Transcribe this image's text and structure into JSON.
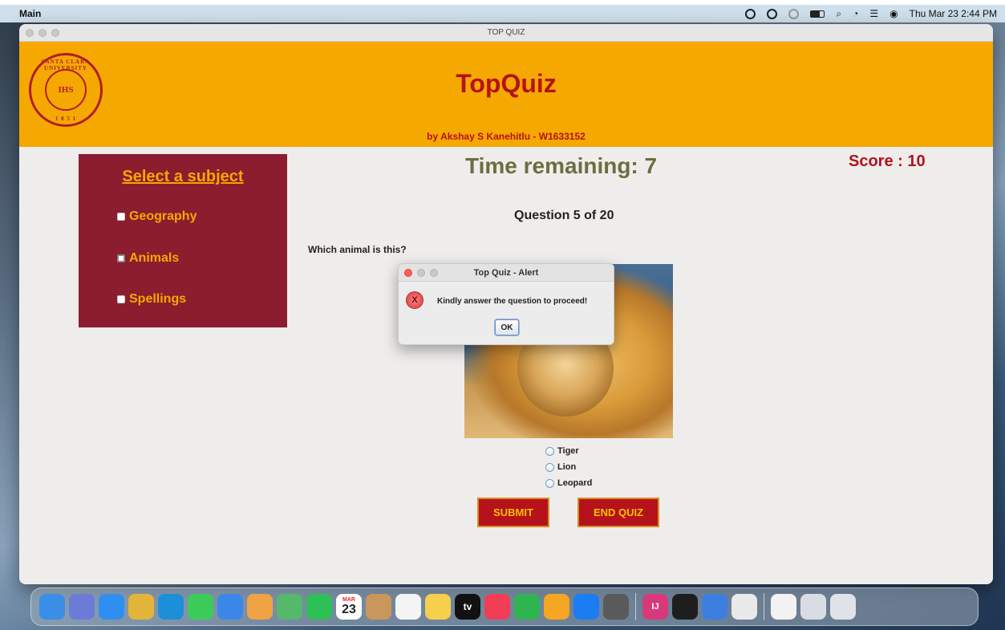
{
  "menubar": {
    "app_name": "Main",
    "datetime": "Thu Mar 23  2:44 PM"
  },
  "window": {
    "title": "TOP QUIZ"
  },
  "header": {
    "title": "TopQuiz",
    "subtitle": "by Akshay S Kanehitlu - W1633152",
    "seal": {
      "ring_top": "SANTA CLARA UNIVERSITY",
      "ring_bottom": "1 8 5 1",
      "center": "IHS"
    }
  },
  "quiz": {
    "time_remaining": "Time remaining: 7",
    "score": "Score : 10",
    "question_number": "Question 5 of 20",
    "question_text": "Which animal is this?",
    "options": [
      "Tiger",
      "Lion",
      "Leopard"
    ],
    "submit_label": "SUBMIT",
    "end_label": "END QUIZ"
  },
  "subjects": {
    "heading": "Select a subject",
    "items": [
      "Geography",
      "Animals",
      "Spellings"
    ],
    "selected": "Animals"
  },
  "alert": {
    "title": "Top Quiz - Alert",
    "icon_text": "X",
    "message": "Kindly answer the question to proceed!",
    "ok_label": "OK"
  },
  "dock": {
    "calendar_month": "MAR",
    "calendar_day": "23",
    "tv_label": "tv",
    "ij_label": "IJ",
    "icons": [
      {
        "name": "finder-icon",
        "color": "#3a8ee6"
      },
      {
        "name": "launchpad-icon",
        "color": "#6c7bd6"
      },
      {
        "name": "safari-icon",
        "color": "#2f8ff0"
      },
      {
        "name": "chrome-icon",
        "color": "#e2b43a"
      },
      {
        "name": "edge-icon",
        "color": "#1c8fd8"
      },
      {
        "name": "messages-icon",
        "color": "#3ccb5a"
      },
      {
        "name": "mail-icon",
        "color": "#3b87e8"
      },
      {
        "name": "photos-icon",
        "color": "#f0a345"
      },
      {
        "name": "maps-icon",
        "color": "#55b86b"
      },
      {
        "name": "facetime-icon",
        "color": "#2fbf57"
      },
      {
        "name": "calendar-icon",
        "color": "#ffffff"
      },
      {
        "name": "contacts-icon",
        "color": "#c9975c"
      },
      {
        "name": "reminders-icon",
        "color": "#f4f4f4"
      },
      {
        "name": "notes-icon",
        "color": "#f6d04d"
      },
      {
        "name": "appletv-icon",
        "color": "#111111"
      },
      {
        "name": "music-icon",
        "color": "#f23d57"
      },
      {
        "name": "numbers-icon",
        "color": "#2fb54f"
      },
      {
        "name": "pages-icon",
        "color": "#f5a623"
      },
      {
        "name": "appstore-icon",
        "color": "#1c7cf2"
      },
      {
        "name": "calculator-icon",
        "color": "#5a5a5a"
      },
      {
        "name": "intellij-icon",
        "color": "#d63a7a"
      },
      {
        "name": "terminal-icon",
        "color": "#1e1e1e"
      },
      {
        "name": "xcode-icon",
        "color": "#3d7fe0"
      },
      {
        "name": "java-icon",
        "color": "#e9e9e9"
      },
      {
        "name": "documents-icon",
        "color": "#f2f2f2"
      },
      {
        "name": "keyboard-icon",
        "color": "#d9dde3"
      },
      {
        "name": "trash-icon",
        "color": "#dfe3e8"
      }
    ]
  }
}
